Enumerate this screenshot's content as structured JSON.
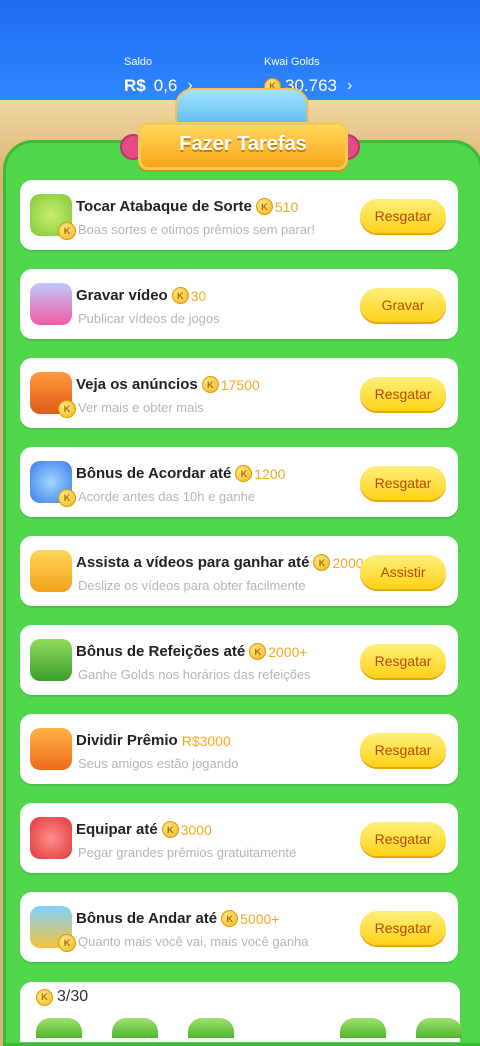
{
  "header": {
    "saldo_label": "Saldo",
    "saldo_currency": "R$",
    "saldo_value": "0,6",
    "golds_label": "Kwai Golds",
    "golds_value": "30.763",
    "chevron": "›"
  },
  "banner": {
    "title": "Fazer Tarefas"
  },
  "coin_symbol": "K",
  "tasks": [
    {
      "title": "Tocar Atabaque de Sorte",
      "reward": "510",
      "subtitle": "Boas sortes e otimos prêmios sem parar!",
      "button": "Resgatar"
    },
    {
      "title": "Gravar vídeo",
      "reward": "30",
      "subtitle": "Publicar vídeos de jogos",
      "button": "Gravar"
    },
    {
      "title": "Veja os anúncios",
      "reward": "17500",
      "subtitle": "Ver mais e obter mais",
      "button": "Resgatar"
    },
    {
      "title": "Bônus de Acordar até",
      "reward": "1200",
      "subtitle": "Acorde antes das 10h e ganhe",
      "button": "Resgatar"
    },
    {
      "title": "Assista a vídeos para ganhar até",
      "reward": "2000",
      "subtitle": "Deslize os vídeos para obter facilmente",
      "button": "Assistir"
    },
    {
      "title": "Bônus de Refeições até",
      "reward": "2000+",
      "subtitle": "Ganhe Golds nos horários das refeições",
      "button": "Resgatar"
    },
    {
      "title": "Dividir Prêmio",
      "reward": "R$3000",
      "subtitle": "Seus amigos estão jogando",
      "button": "Resgatar"
    },
    {
      "title": "Equipar até",
      "reward": "3000",
      "subtitle": "Pegar grandes prêmios gratuitamente",
      "button": "Resgatar"
    },
    {
      "title": "Bônus de Andar até",
      "reward": "5000+",
      "subtitle": "Quanto mais você vai, mais você ganha",
      "button": "Resgatar"
    }
  ],
  "progress": {
    "text": "3/30"
  },
  "colors": {
    "top_blue": "#1e6cf0",
    "board_green": "#4fd64b",
    "button_yellow": "#ffd21a",
    "reward_orange": "#f4a91d"
  }
}
